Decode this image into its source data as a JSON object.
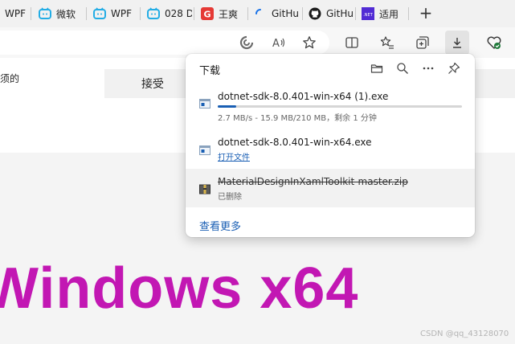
{
  "tabs": [
    {
      "label": "WPF",
      "icon": "none"
    },
    {
      "label": "微软",
      "icon": "bilibili-icon"
    },
    {
      "label": "WPF",
      "icon": "bilibili-icon"
    },
    {
      "label": "028 D",
      "icon": "bilibili-icon"
    },
    {
      "label": "王爽",
      "icon": "red-g-icon"
    },
    {
      "label": "GitHu",
      "icon": "loading-spinner-icon"
    },
    {
      "label": "GitHu",
      "icon": "github-icon"
    },
    {
      "label": "适用",
      "icon": "dotnet-icon"
    }
  ],
  "new_tab_label": "+",
  "page": {
    "left_text": "须的",
    "accept_button": "接受",
    "big_title": "Windows x64",
    "watermark": "CSDN @qq_43128070"
  },
  "downloads": {
    "title": "下载",
    "see_more": "查看更多",
    "items": [
      {
        "name": "dotnet-sdk-8.0.401-win-x64 (1).exe",
        "status": "2.7 MB/s - 15.9 MB/210 MB，剩余 1 分钟",
        "progress": 0.075,
        "state": "downloading"
      },
      {
        "name": "dotnet-sdk-8.0.401-win-x64.exe",
        "action": "打开文件",
        "state": "complete"
      },
      {
        "name": "MaterialDesignInXamlToolkit-master.zip",
        "status": "已删除",
        "state": "deleted"
      }
    ]
  },
  "colors": {
    "accent_blue": "#1a5fb4",
    "title_magenta": "#c217b3",
    "bilibili_blue": "#23ade5",
    "dotnet_purple": "#512bd4"
  }
}
